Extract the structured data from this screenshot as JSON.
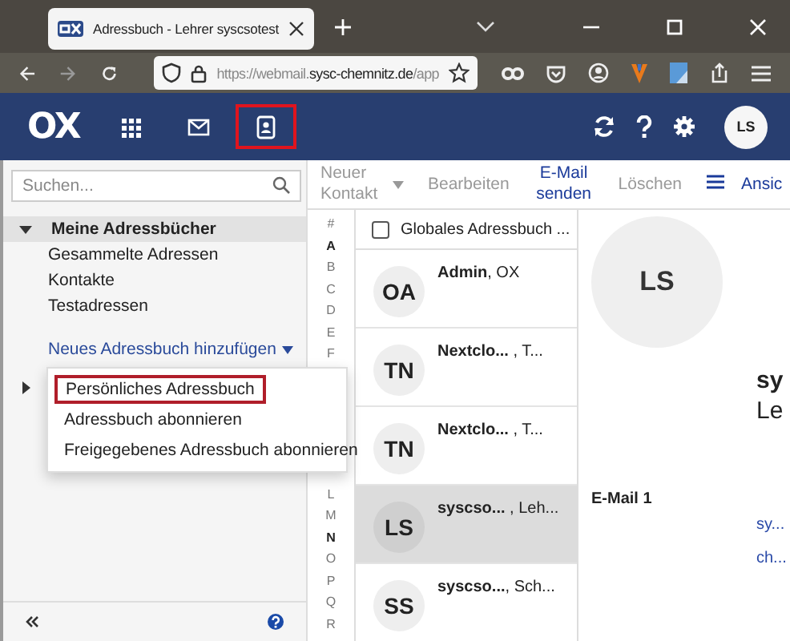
{
  "browser": {
    "tab": {
      "title": "Adressbuch - Lehrer syscsotest"
    },
    "url": {
      "host_start": "https://webmail.",
      "domain": "sysc-chemnitz.de",
      "path": "/app"
    }
  },
  "app_header": {
    "logo": "OX",
    "apps": [
      {
        "kind": "grid",
        "selected": false
      },
      {
        "kind": "mail",
        "selected": false
      },
      {
        "kind": "contacts",
        "selected": true
      }
    ],
    "avatar": "LS"
  },
  "sidebar": {
    "search": {
      "placeholder": "Suchen..."
    },
    "sections": [
      {
        "title": "Meine Adressbücher",
        "expanded": true,
        "selected": true,
        "items": [
          "Gesammelte Adressen",
          "Kontakte",
          "Testadressen"
        ]
      },
      {
        "expanded": false,
        "selected": false
      }
    ],
    "add_link": "Neues Adressbuch hinzufügen"
  },
  "menu": {
    "items": [
      {
        "label": "Persönliches Adressbuch",
        "focused": true
      },
      {
        "label": "Adressbuch abonnieren",
        "focused": false
      },
      {
        "label": "Freigegebenes Adressbuch abonnieren",
        "focused": false
      }
    ]
  },
  "toolbar": {
    "items": [
      {
        "kind": "dropdown",
        "label": "Neuer Kontakt",
        "disabled": true
      },
      {
        "kind": "text",
        "label": "Bearbeiten",
        "disabled": true
      },
      {
        "kind": "text",
        "label": "E-Mail senden",
        "disabled": false
      },
      {
        "kind": "text",
        "label": "Löschen",
        "disabled": true
      },
      {
        "kind": "menu",
        "disabled": false
      },
      {
        "kind": "text",
        "label": "Ansic",
        "disabled": false
      }
    ]
  },
  "index_top": [
    {
      "letter": "#",
      "bold": false
    },
    {
      "letter": "A",
      "bold": true
    },
    {
      "letter": "B",
      "bold": false
    },
    {
      "letter": "C",
      "bold": false
    },
    {
      "letter": "D",
      "bold": false
    },
    {
      "letter": "E",
      "bold": false
    },
    {
      "letter": "F",
      "bold": false
    }
  ],
  "index_bottom": [
    {
      "letter": "L",
      "bold": false
    },
    {
      "letter": "M",
      "bold": false
    },
    {
      "letter": "N",
      "bold": true
    },
    {
      "letter": "O",
      "bold": false
    },
    {
      "letter": "P",
      "bold": false
    },
    {
      "letter": "Q",
      "bold": false
    },
    {
      "letter": "R",
      "bold": false
    }
  ],
  "list": {
    "title": "Globales Adressbuch ...",
    "checked": false,
    "contacts": [
      {
        "initials": "OA",
        "name": "**Admin**, OX",
        "selected": false
      },
      {
        "initials": "TN",
        "name": "**Nextclo...** , T...",
        "selected": false
      },
      {
        "initials": "TN",
        "name": "**Nextclo...** , T...",
        "selected": false
      },
      {
        "initials": "LS",
        "name": "**syscso...** , Leh...",
        "selected": true
      },
      {
        "initials": "SS",
        "name": "**syscso...**, Sch...",
        "selected": false
      }
    ]
  },
  "detail": {
    "initials": "LS",
    "name": "sy",
    "subtitle": "Le",
    "field_label": "E-Mail 1",
    "links": [
      "sy...",
      "ch..."
    ]
  }
}
